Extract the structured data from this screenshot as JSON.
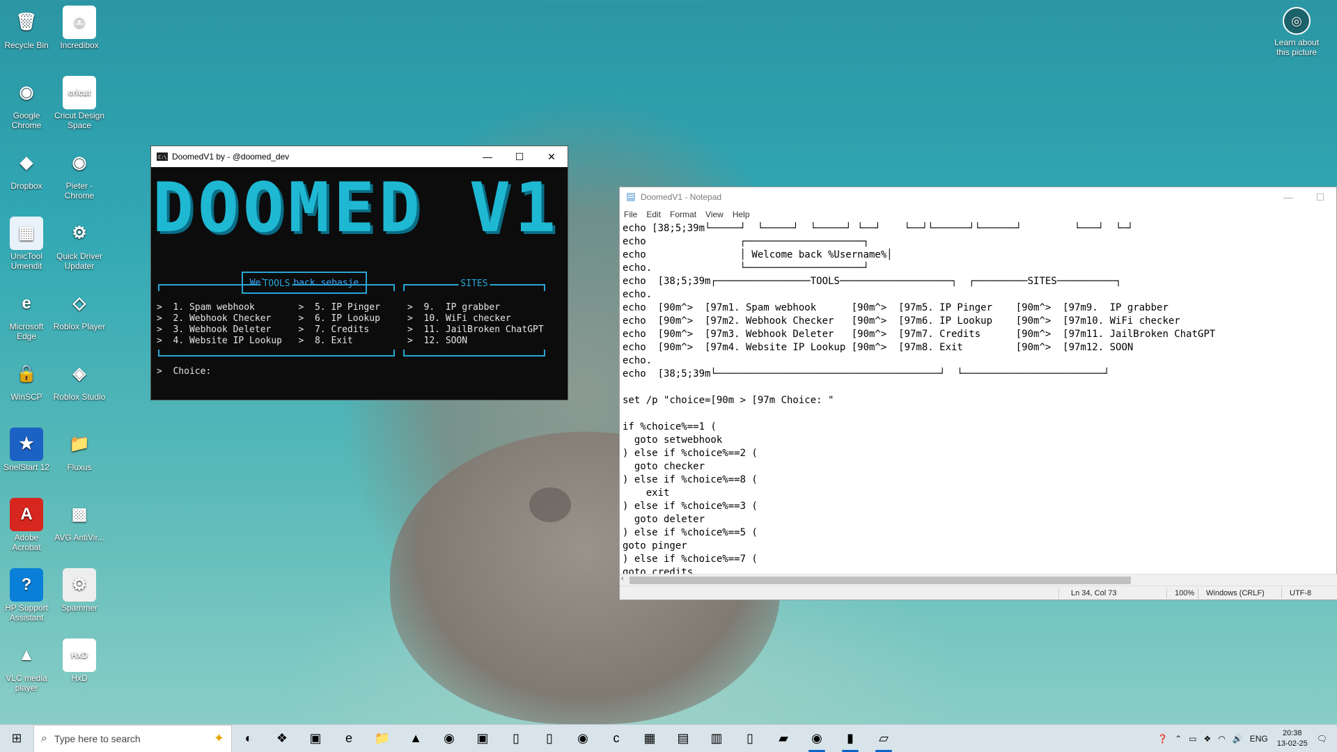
{
  "desktop": {
    "icons": [
      {
        "label": "Recycle Bin",
        "glyph": "🗑",
        "bg": "transparent"
      },
      {
        "label": "Incredibox",
        "glyph": "☺",
        "bg": "#ffffff"
      },
      {
        "label": "Google Chrome",
        "glyph": "◉",
        "bg": "transparent"
      },
      {
        "label": "Cricut Design Space",
        "glyph": "cricut",
        "bg": "#ffffff"
      },
      {
        "label": "Dropbox",
        "glyph": "◆",
        "bg": "transparent"
      },
      {
        "label": "Pieter - Chrome",
        "glyph": "◉",
        "bg": "transparent"
      },
      {
        "label": "UnicTool Umendit",
        "glyph": "▦",
        "bg": "#e9f1fb"
      },
      {
        "label": "Quick Driver Updater",
        "glyph": "⚙",
        "bg": "transparent"
      },
      {
        "label": "Microsoft Edge",
        "glyph": "e",
        "bg": "transparent"
      },
      {
        "label": "Roblox Player",
        "glyph": "◇",
        "bg": "transparent"
      },
      {
        "label": "WinSCP",
        "glyph": "🔒",
        "bg": "transparent"
      },
      {
        "label": "Roblox Studio",
        "glyph": "◈",
        "bg": "transparent"
      },
      {
        "label": "SnelStart 12",
        "glyph": "★",
        "bg": "#1c62c4"
      },
      {
        "label": "Fluxus",
        "glyph": "📁",
        "bg": "transparent"
      },
      {
        "label": "Adobe Acrobat",
        "glyph": "A",
        "bg": "#d7261e"
      },
      {
        "label": "AVG AntiVir...",
        "glyph": "▩",
        "bg": "transparent"
      },
      {
        "label": "HP Support Assistant",
        "glyph": "?",
        "bg": "#0a7fd8"
      },
      {
        "label": "Spammer",
        "glyph": "⚙",
        "bg": "#eeeeee"
      },
      {
        "label": "VLC media player",
        "glyph": "▲",
        "bg": "transparent"
      },
      {
        "label": "HxD",
        "glyph": "HxD",
        "bg": "#ffffff"
      }
    ],
    "learn_label": "Learn about this picture"
  },
  "cmd": {
    "title": "DoomedV1 by - @doomed_dev",
    "banner": "DOOMED V1",
    "welcome": "Welcome back sebasje",
    "tools_label": "TOOLS",
    "sites_label": "SITES",
    "lines": [
      ">  1. Spam webhook        >  5. IP Pinger     >  9.  IP grabber",
      ">  2. Webhook Checker     >  6. IP Lookup     >  10. WiFi checker",
      ">  3. Webhook Deleter     >  7. Credits       >  11. JailBroken ChatGPT",
      ">  4. Website IP Lookup   >  8. Exit          >  12. SOON"
    ],
    "prompt": ">  Choice:"
  },
  "notepad": {
    "title": "DoomedV1 - Notepad",
    "menu": [
      "File",
      "Edit",
      "Format",
      "View",
      "Help"
    ],
    "lines": [
      "echo \u0010[38;5;39m└─────┘  └─────┘  └─────┘ └──┘    └──┘└──────┘└──────┘         └───┘  └─┘",
      "echo                ┌────────────────────┐",
      "echo                │ Welcome back %Username%│",
      "echo.               └────────────────────┘",
      "echo  \u0010[38;5;39m┌────────────────TOOLS───────────────────┐  ┌─────────SITES──────────┐",
      "echo.",
      "echo  \u0010[90m^>  \u0010[97m1. Spam webhook      \u0010[90m^>  \u0010[97m5. IP Pinger    \u0010[90m^>  \u0010[97m9.  IP grabber",
      "echo  \u0010[90m^>  \u0010[97m2. Webhook Checker   \u0010[90m^>  \u0010[97m6. IP Lookup    \u0010[90m^>  \u0010[97m10. WiFi checker",
      "echo  \u0010[90m^>  \u0010[97m3. Webhook Deleter   \u0010[90m^>  \u0010[97m7. Credits      \u0010[90m^>  \u0010[97m11. JailBroken ChatGPT",
      "echo  \u0010[90m^>  \u0010[97m4. Website IP Lookup \u0010[90m^>  \u0010[97m8. Exit         \u0010[90m^>  \u0010[97m12. SOON",
      "echo.",
      "echo  \u0010[38;5;39m└──────────────────────────────────────┘  └────────────────────────┘",
      "",
      "set /p \"choice=\u0010[90m > \u0010[97m Choice: \"",
      "",
      "if %choice%==1 (",
      "  goto setwebhook",
      ") else if %choice%==2 (",
      "  goto checker",
      ") else if %choice%==8 (",
      "    exit",
      ") else if %choice%==3 (",
      "  goto deleter",
      ") else if %choice%==5 (",
      "goto pinger",
      ") else if %choice%==7 (",
      "goto credits"
    ],
    "status": {
      "position": "Ln 34, Col 73",
      "zoom": "100%",
      "line_ending": "Windows (CRLF)",
      "encoding": "UTF-8"
    }
  },
  "taskbar": {
    "search_placeholder": "Type here to search",
    "apps": [
      "copilot",
      "dropbox",
      "task",
      "edge",
      "explorer",
      "cat",
      "obs",
      "app",
      "file1",
      "file2",
      "chrome",
      "cricut",
      "app2",
      "app3",
      "app4",
      "file3",
      "app5",
      "chrome2",
      "terminal",
      "notepad"
    ],
    "language": "ENG",
    "time": "20:38",
    "date": "13-02-25"
  }
}
